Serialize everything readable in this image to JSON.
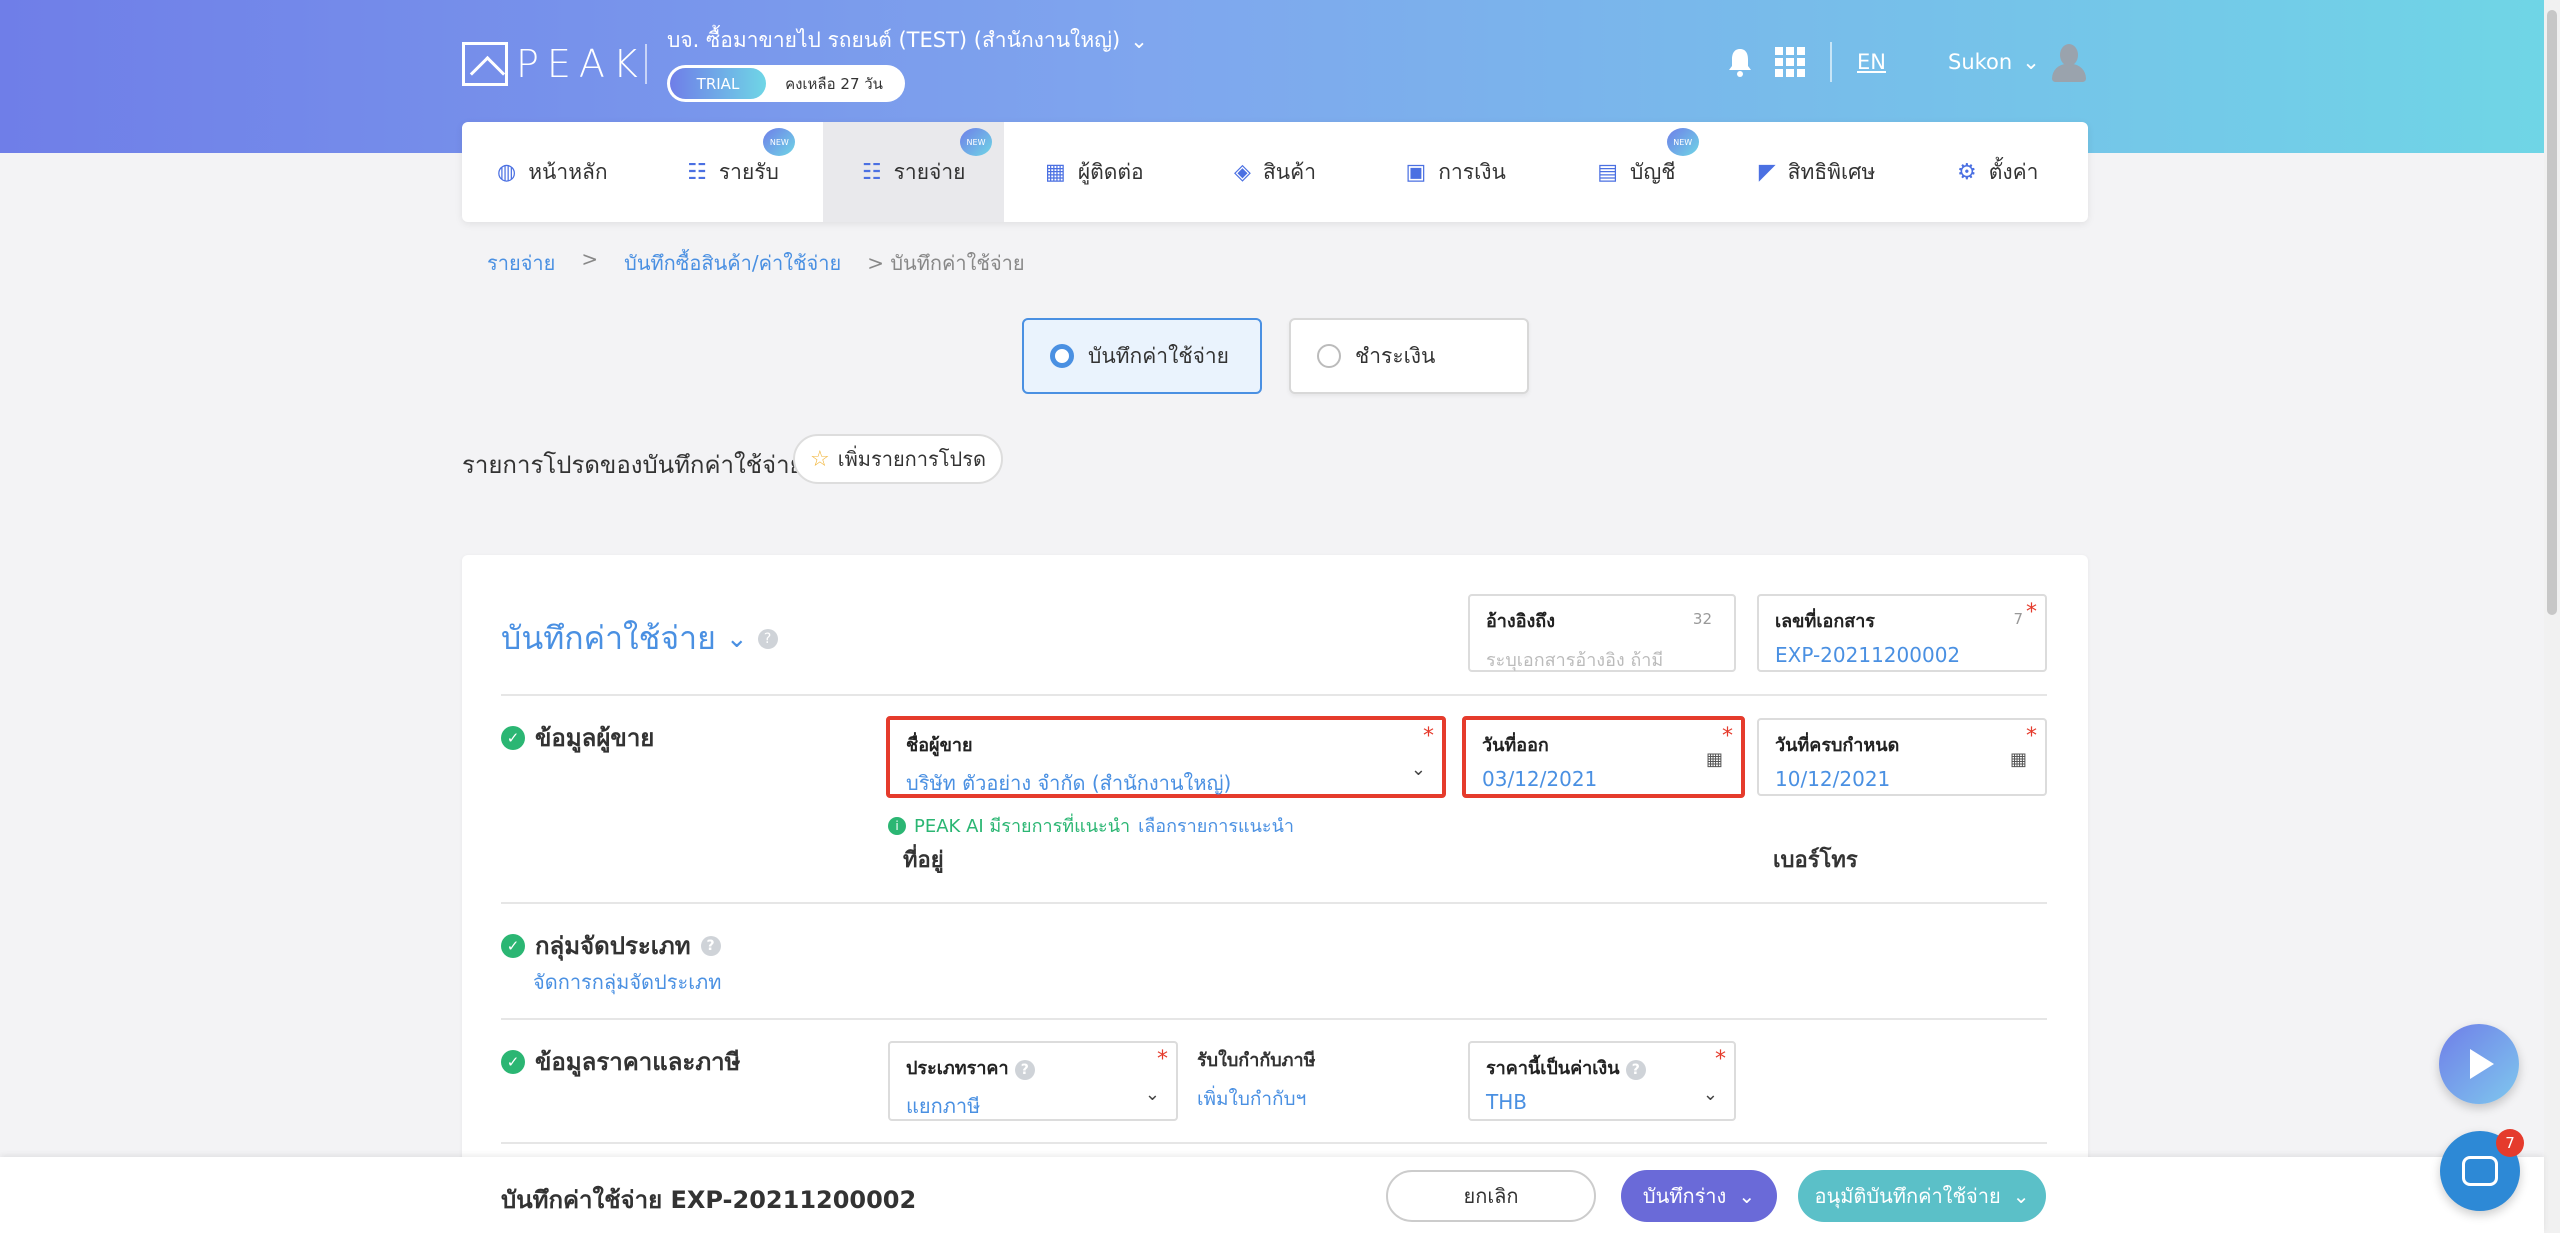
{
  "header": {
    "logo_text": "PEAK",
    "company": "บจ. ซื้อมาขายไป รถยนต์ (TEST) (สำนักงานใหญ่)",
    "trial_label": "TRIAL",
    "trial_remaining": "คงเหลือ 27 วัน",
    "lang": "EN",
    "user": "Sukon"
  },
  "nav": {
    "items": [
      {
        "label": "หน้าหลัก",
        "icon": "dashboard-icon"
      },
      {
        "label": "รายรับ",
        "icon": "list-icon",
        "badge": "NEW"
      },
      {
        "label": "รายจ่าย",
        "icon": "list-icon",
        "badge": "NEW",
        "active": true
      },
      {
        "label": "ผู้ติดต่อ",
        "icon": "building-icon"
      },
      {
        "label": "สินค้า",
        "icon": "box-icon"
      },
      {
        "label": "การเงิน",
        "icon": "money-icon"
      },
      {
        "label": "บัญชี",
        "icon": "book-icon",
        "badge": "NEW"
      },
      {
        "label": "สิทธิพิเศษ",
        "icon": "megaphone-icon"
      },
      {
        "label": "ตั้งค่า",
        "icon": "gear-icon"
      }
    ]
  },
  "breadcrumb": {
    "level1": "รายจ่าย",
    "level2": "บันทึกซื้อสินค้า/ค่าใช้จ่าย",
    "current": "บันทึกค่าใช้จ่าย",
    "sep": ">"
  },
  "mode": {
    "record": "บันทึกค่าใช้จ่าย",
    "pay": "ชำระเงิน"
  },
  "favorites": {
    "title": "รายการโปรดของบันทึกค่าใช้จ่าย",
    "add_button": "เพิ่มรายการโปรด"
  },
  "form": {
    "title": "บันทึกค่าใช้จ่าย",
    "reference": {
      "label": "อ้างอิงถึง",
      "placeholder": "ระบุเอกสารอ้างอิง ถ้ามี",
      "count": "32"
    },
    "doc_no": {
      "label": "เลขที่เอกสาร",
      "value": "EXP-20211200002",
      "count": "7"
    },
    "vendor_section": "ข้อมูลผู้ขาย",
    "vendor": {
      "label": "ชื่อผู้ขาย",
      "value": "บริษัท ตัวอย่าง จำกัด (สำนักงานใหญ่)"
    },
    "issue_date": {
      "label": "วันที่ออก",
      "value": "03/12/2021"
    },
    "due_date": {
      "label": "วันที่ครบกำหนด",
      "value": "10/12/2021"
    },
    "ai_hint": "PEAK AI มีรายการที่แนะนำ",
    "ai_link": "เลือกรายการแนะนำ",
    "address_label": "ที่อยู่",
    "phone_label": "เบอร์โทร",
    "category_section": "กลุ่มจัดประเภท",
    "category_link": "จัดการกลุ่มจัดประเภท",
    "price_section": "ข้อมูลราคาและภาษี",
    "price_type": {
      "label": "ประเภทราคา",
      "value": "แยกภาษี"
    },
    "wht": {
      "label": "รับใบกำกับภาษี",
      "link": "เพิ่มใบกำกับฯ"
    },
    "currency": {
      "label": "ราคานี้เป็นค่าเงิน",
      "value": "THB"
    }
  },
  "footer": {
    "title": "บันทึกค่าใช้จ่าย EXP-20211200002",
    "cancel": "ยกเลิก",
    "draft": "บันทึกร่าง",
    "approve": "อนุมัติบันทึกค่าใช้จ่าย"
  },
  "chat": {
    "badge": "7"
  }
}
